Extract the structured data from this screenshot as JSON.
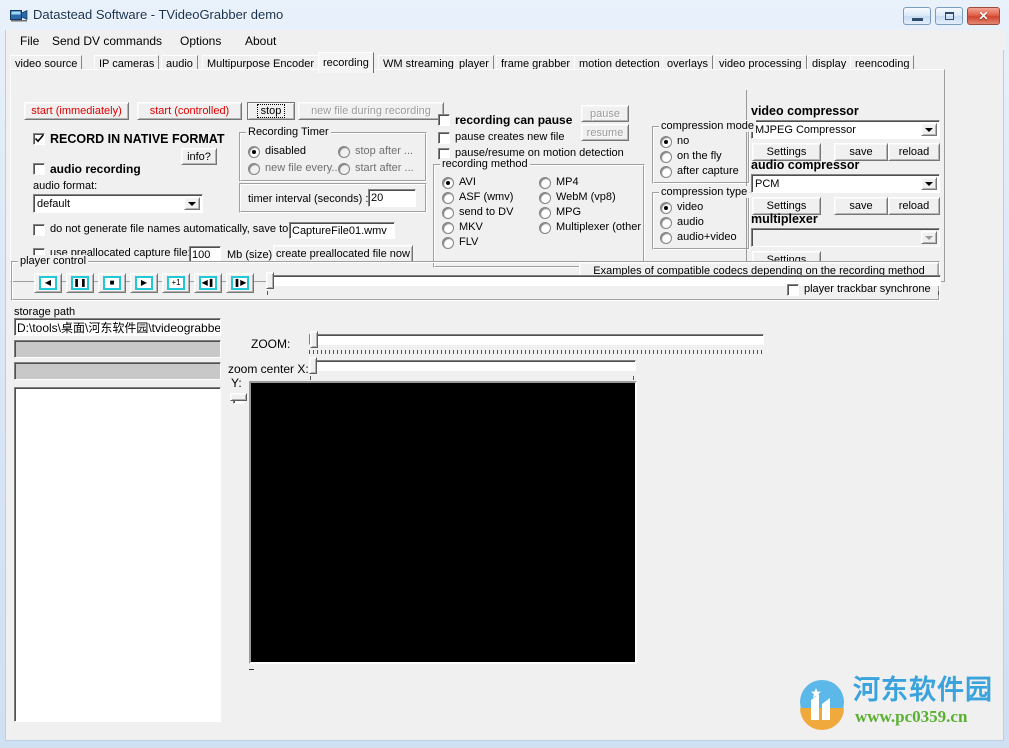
{
  "window": {
    "title": "Datastead Software - TVideoGrabber demo",
    "icon": "camcorder-icon",
    "buttons": {
      "minimize": "minimize-icon",
      "maximize": "maximize-icon",
      "close": "close-icon"
    }
  },
  "menubar": {
    "items": [
      {
        "label": "File"
      },
      {
        "label": "Send DV commands"
      },
      {
        "label": "Options"
      },
      {
        "label": "About"
      }
    ]
  },
  "tabs": {
    "selected": "recording",
    "items": [
      {
        "label": "video source"
      },
      {
        "label": "IP cameras"
      },
      {
        "label": "audio"
      },
      {
        "label": "Multipurpose Encoder"
      },
      {
        "label": "recording"
      },
      {
        "label": "WM streaming"
      },
      {
        "label": "player"
      },
      {
        "label": "frame grabber"
      },
      {
        "label": "motion detection"
      },
      {
        "label": "overlays"
      },
      {
        "label": "video processing"
      },
      {
        "label": "display"
      },
      {
        "label": "reencoding"
      }
    ]
  },
  "recording_tab": {
    "action_buttons": [
      {
        "label": "start (immediately)",
        "style": "red",
        "state": "enabled"
      },
      {
        "label": "start (controlled)",
        "style": "red",
        "state": "enabled"
      },
      {
        "label": "stop",
        "style": "normal",
        "state": "focused"
      },
      {
        "label": "new file during recording",
        "style": "normal",
        "state": "disabled"
      }
    ],
    "native_format": {
      "label": "RECORD IN NATIVE FORMAT",
      "checked": true
    },
    "info_button": {
      "label": "info?"
    },
    "audio_recording": {
      "label": "audio recording",
      "checked": false
    },
    "audio_format": {
      "label": "audio format:",
      "value": "default"
    },
    "no_autogen": {
      "label": "do not generate file names automatically, save to:",
      "checked": false
    },
    "save_to_value": "CaptureFile01.wmv",
    "preallocated": {
      "label": "use preallocated capture file:",
      "checked": false
    },
    "preallocated_size": "100",
    "mb_label": "Mb (size)",
    "create_prealloc_button": "create preallocated file now",
    "recording_timer": {
      "title": "Recording Timer",
      "options": [
        {
          "label": "disabled",
          "selected": true
        },
        {
          "label": "stop after ...",
          "selected": false
        },
        {
          "label": "new file every...",
          "selected": false
        },
        {
          "label": "start after ...",
          "selected": false
        }
      ],
      "interval_label": "timer interval (seconds) :",
      "interval_value": "20"
    },
    "pause_checks": [
      {
        "label": "recording can pause",
        "checked": false,
        "bold": true
      },
      {
        "label": "pause creates new file",
        "checked": false,
        "bold": false
      },
      {
        "label": "pause/resume on motion detection",
        "checked": false,
        "bold": false
      }
    ],
    "pause_button": {
      "label": "pause",
      "state": "disabled"
    },
    "resume_button": {
      "label": "resume",
      "state": "disabled"
    },
    "recording_method": {
      "title": "recording method",
      "left_options": [
        {
          "label": "AVI",
          "selected": true
        },
        {
          "label": "ASF (wmv)",
          "selected": false
        },
        {
          "label": "send to DV",
          "selected": false
        },
        {
          "label": "MKV",
          "selected": false
        },
        {
          "label": "FLV",
          "selected": false
        }
      ],
      "right_options": [
        {
          "label": "MP4",
          "selected": false
        },
        {
          "label": "WebM (vp8)",
          "selected": false
        },
        {
          "label": "MPG",
          "selected": false
        },
        {
          "label": "Multiplexer (other",
          "selected": false
        }
      ]
    },
    "compression_mode": {
      "title": "compression mode",
      "options": [
        {
          "label": "no",
          "selected": true
        },
        {
          "label": "on the fly",
          "selected": false
        },
        {
          "label": "after capture",
          "selected": false
        }
      ]
    },
    "compression_type": {
      "title": "compression type",
      "options": [
        {
          "label": "video",
          "selected": true
        },
        {
          "label": "audio",
          "selected": false
        },
        {
          "label": "audio+video",
          "selected": false
        }
      ]
    },
    "video_compressor": {
      "title": "video compressor",
      "value": "MJPEG Compressor",
      "settings_label": "Settings",
      "save_label": "save",
      "reload_label": "reload"
    },
    "audio_compressor": {
      "title": "audio compressor",
      "value": "PCM",
      "settings_label": "Settings",
      "save_label": "save",
      "reload_label": "reload"
    },
    "multiplexer": {
      "title": "multiplexer",
      "value": "",
      "settings_label": "Settings"
    },
    "examples_button": "Examples of compatible codecs depending on the recording method"
  },
  "player_control": {
    "title": "player control",
    "buttons": [
      {
        "name": "rewind-button",
        "glyph": "◀"
      },
      {
        "name": "pause-button",
        "glyph": "❚❚"
      },
      {
        "name": "stop-button",
        "glyph": "■"
      },
      {
        "name": "play-button",
        "glyph": "▶"
      },
      {
        "name": "step-forward-button",
        "glyph": "+1"
      },
      {
        "name": "prev-frame-button",
        "glyph": "◀❚"
      },
      {
        "name": "next-frame-button",
        "glyph": "❚▶"
      }
    ],
    "trackbar_value": 0,
    "synchrone_checkbox": {
      "label": "player trackbar synchrone",
      "checked": false
    }
  },
  "storage": {
    "label": "storage path",
    "path": "D:\\tools\\桌面\\河东软件园\\tvideograbbe"
  },
  "zoom_panel": {
    "zoom_label": "ZOOM:",
    "zoom_value": 0,
    "center_x_label": "zoom center X:",
    "center_x_value": 0,
    "center_y_label": "Y:",
    "center_y_value": 0
  },
  "preview": {
    "name": "video-preview",
    "color": "#000000"
  },
  "watermark": {
    "site_name": "河东软件园",
    "url": "www.pc0359.cn"
  }
}
